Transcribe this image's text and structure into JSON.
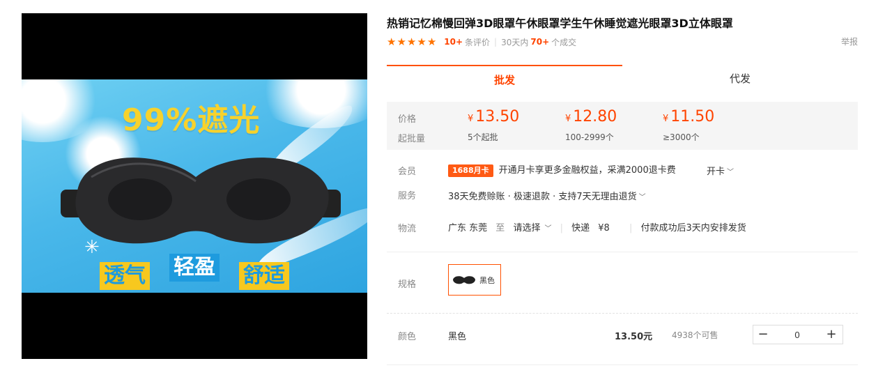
{
  "gallery": {
    "headline": "99%遮光",
    "tags": [
      "透气",
      "轻盈",
      "舒适"
    ]
  },
  "product": {
    "title": "热销记忆棉慢回弹3D眼罩午休眼罩学生午休睡觉遮光眼罩3D立体眼罩"
  },
  "rating": {
    "stars": 5,
    "review_count": "10+",
    "review_label": "条评价",
    "period_label": "30天内",
    "sold_count": "70+",
    "sold_label": "个成交",
    "report_label": "举报"
  },
  "tabs": [
    {
      "label": "批发"
    },
    {
      "label": "代发"
    }
  ],
  "price_box": {
    "price_label": "价格",
    "moq_label": "起批量",
    "currency": "¥",
    "tiers": [
      {
        "price": "13.50",
        "qty": "5个起批"
      },
      {
        "price": "12.80",
        "qty": "100-2999个"
      },
      {
        "price": "11.50",
        "qty": "≥3000个"
      }
    ]
  },
  "member": {
    "label": "会员",
    "badge": "1688月卡",
    "text": "开通月卡享更多金融权益，采满2000退卡费",
    "action": "开卡"
  },
  "service": {
    "label": "服务",
    "text": "38天免费赊账 · 极速退款 · 支持7天无理由退货"
  },
  "logistics": {
    "label": "物流",
    "origin": "广东 东莞",
    "to": "至",
    "destination": "请选择",
    "method": "快递",
    "fee": "¥8",
    "shipping_note": "付款成功后3天内安排发货"
  },
  "spec": {
    "label": "规格",
    "option": "黑色"
  },
  "color_row": {
    "label": "颜色",
    "name": "黑色",
    "price": "13.50元",
    "stock": "4938个可售",
    "quantity": "0",
    "minus": "−",
    "plus": "+"
  },
  "colors": {
    "accent": "#ff4400",
    "badge": "#ff5a14",
    "star": "#ff7300",
    "headline_yellow": "#f7d22c",
    "sky_blue": "#4ab8ea"
  }
}
